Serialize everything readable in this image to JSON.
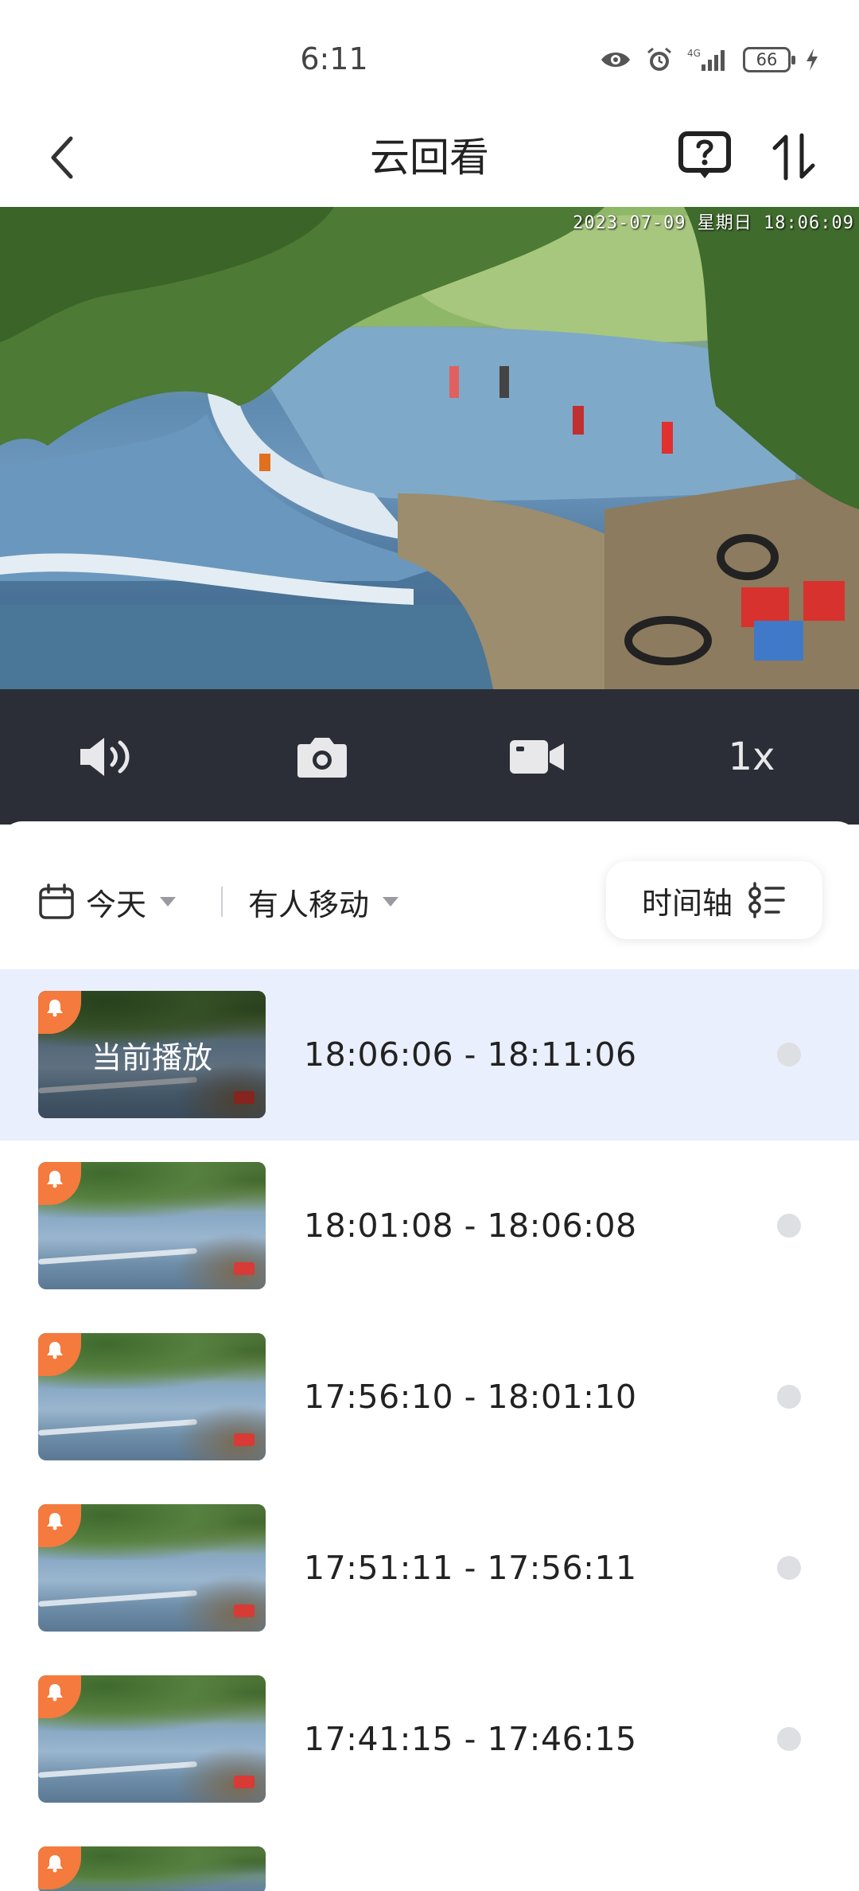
{
  "status_bar": {
    "time": "6:11",
    "network": "4G",
    "battery": "66"
  },
  "header": {
    "title": "云回看"
  },
  "video": {
    "osd_text": "2023-07-09 星期日 18:06:09"
  },
  "controls": {
    "speed_label": "1x"
  },
  "filters": {
    "date_label": "今天",
    "event_label": "有人移动",
    "timeline_label": "时间轴"
  },
  "clips": [
    {
      "range": "18:06:06 - 18:11:06",
      "now_playing": "当前播放"
    },
    {
      "range": "18:01:08 - 18:06:08"
    },
    {
      "range": "17:56:10 - 18:01:10"
    },
    {
      "range": "17:51:11 - 17:56:11"
    },
    {
      "range": "17:41:15 - 17:46:15"
    }
  ],
  "colors": {
    "accent_badge": "#f47a3d",
    "active_row": "#e9effc",
    "controls_bg": "#2b2e37"
  }
}
